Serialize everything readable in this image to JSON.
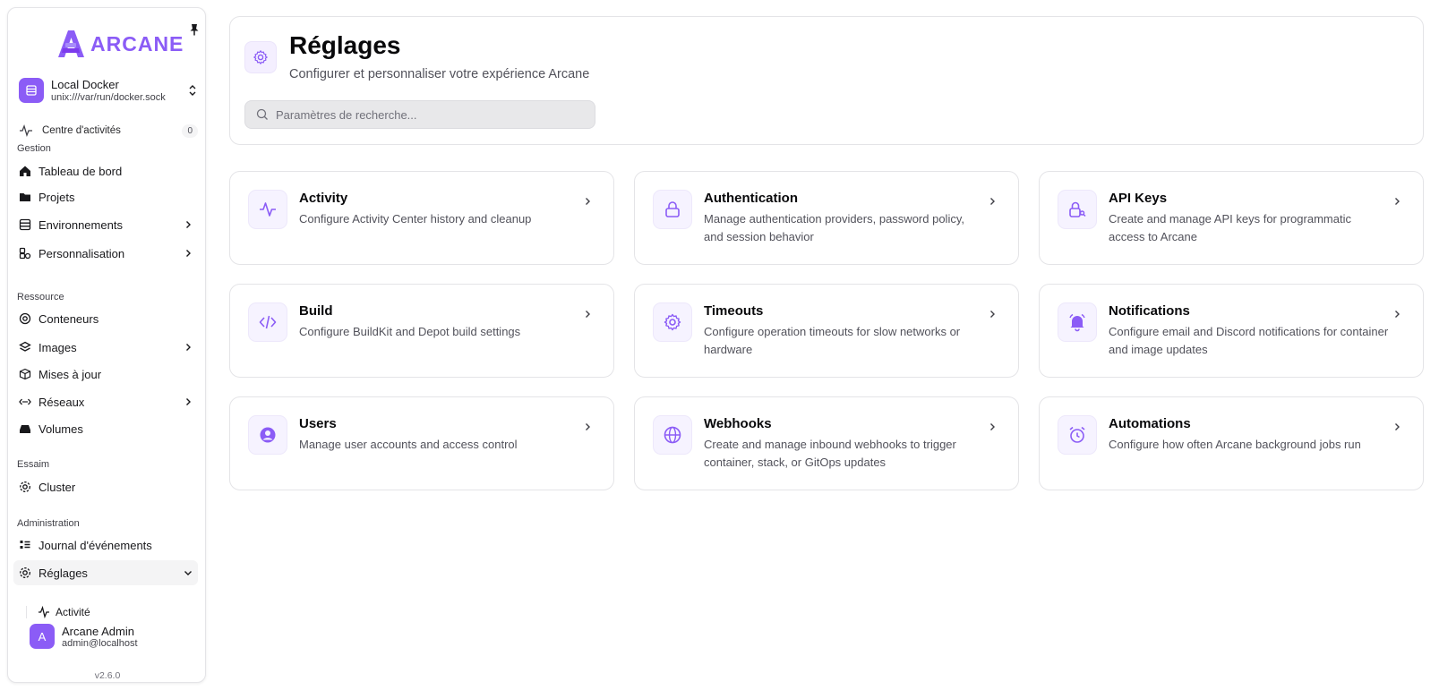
{
  "sidebar": {
    "brand": "ARCANE",
    "environment": {
      "name": "Local Docker",
      "socket": "unix:///var/run/docker.sock"
    },
    "activity_center": {
      "label": "Centre d'activités",
      "count": "0"
    },
    "sections": {
      "gestion": "Gestion",
      "ressource": "Ressource",
      "essaim": "Essaim",
      "administration": "Administration"
    },
    "items": {
      "dashboard": "Tableau de bord",
      "projects": "Projets",
      "environments": "Environnements",
      "personalization": "Personnalisation",
      "containers": "Conteneurs",
      "images": "Images",
      "updates": "Mises à jour",
      "networks": "Réseaux",
      "volumes": "Volumes",
      "cluster": "Cluster",
      "events": "Journal d'événements",
      "settings": "Réglages",
      "settings_activity": "Activité"
    },
    "user": {
      "initial": "A",
      "name": "Arcane Admin",
      "email": "admin@localhost"
    },
    "version": "v2.6.0",
    "accent_color": "#8b5cf6"
  },
  "header": {
    "title": "Réglages",
    "subtitle": "Configurer et personnaliser votre expérience Arcane",
    "search_placeholder": "Paramètres de recherche..."
  },
  "cards": [
    {
      "title": "Activity",
      "desc": "Configure Activity Center history and cleanup",
      "icon": "activity-icon"
    },
    {
      "title": "Authentication",
      "desc": "Manage authentication providers, password policy, and session behavior",
      "icon": "lock-icon"
    },
    {
      "title": "API Keys",
      "desc": "Create and manage API keys for programmatic access to Arcane",
      "icon": "lock-key-icon"
    },
    {
      "title": "Build",
      "desc": "Configure BuildKit and Depot build settings",
      "icon": "code-icon"
    },
    {
      "title": "Timeouts",
      "desc": "Configure operation timeouts for slow networks or hardware",
      "icon": "gear-icon"
    },
    {
      "title": "Notifications",
      "desc": "Configure email and Discord notifications for container and image updates",
      "icon": "bell-icon"
    },
    {
      "title": "Users",
      "desc": "Manage user accounts and access control",
      "icon": "user-circle-icon"
    },
    {
      "title": "Webhooks",
      "desc": "Create and manage inbound webhooks to trigger container, stack, or GitOps updates",
      "icon": "globe-icon"
    },
    {
      "title": "Automations",
      "desc": "Configure how often Arcane background jobs run",
      "icon": "alarm-clock-icon"
    }
  ]
}
